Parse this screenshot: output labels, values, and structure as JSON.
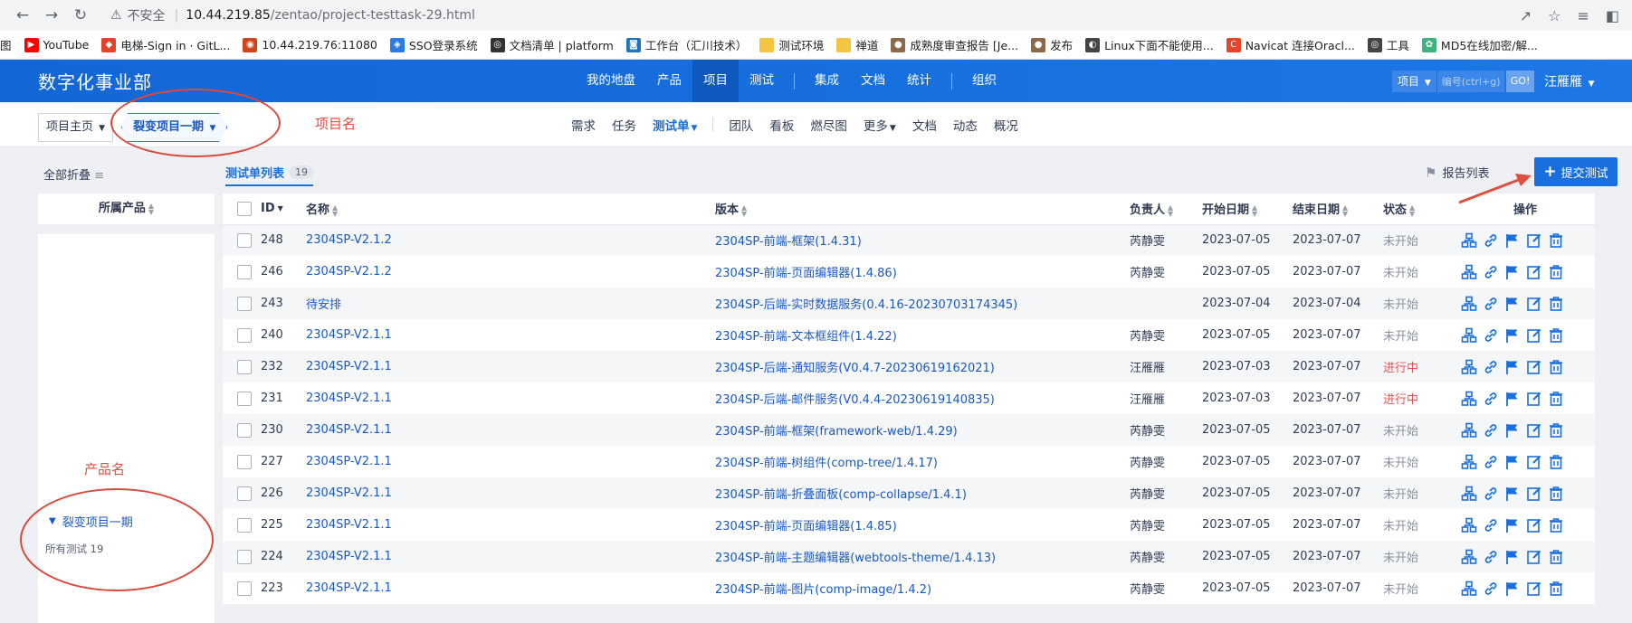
{
  "browser": {
    "insecure_label": "不安全",
    "url_host": "10.44.219.85",
    "url_path": "/zentao/project-testtask-29.html",
    "bookmarks": [
      "图",
      "YouTube",
      "电梯-Sign in · GitL...",
      "10.44.219.76:11080",
      "SSO登录系统",
      "文档清单 | platform",
      "工作台（汇川技术）",
      "测试环境",
      "禅道",
      "成熟度审查报告 [Je...",
      "发布",
      "Linux下面不能使用...",
      "Navicat 连接Oracl...",
      "工具",
      "MD5在线加密/解..."
    ]
  },
  "header": {
    "brand": "数字化事业部",
    "nav": [
      "我的地盘",
      "产品",
      "项目",
      "测试",
      "集成",
      "文档",
      "统计",
      "组织"
    ],
    "active_nav": "项目",
    "search_scope": "项目",
    "search_placeholder": "编号(ctrl+g)",
    "go_label": "GO!",
    "user": "汪雁雁"
  },
  "subheader": {
    "home": "项目主页",
    "project": "裂变项目一期",
    "nav": [
      "需求",
      "任务",
      "测试单",
      "团队",
      "看板",
      "燃尽图",
      "更多",
      "文档",
      "动态",
      "概况"
    ],
    "active_nav": "测试单"
  },
  "toolbar": {
    "collapse_all": "全部折叠",
    "tab_label": "测试单列表",
    "tab_count": "19",
    "report_list": "报告列表",
    "submit_label": "提交测试"
  },
  "sidebar": {
    "header": "所属产品",
    "node": "裂变项目一期",
    "all_tests": "所有测试 19"
  },
  "annotations": {
    "project_name": "项目名",
    "product_name": "产品名"
  },
  "table": {
    "columns": [
      "ID",
      "名称",
      "版本",
      "负责人",
      "开始日期",
      "结束日期",
      "状态",
      "操作"
    ],
    "rows": [
      {
        "id": "248",
        "name": "2304SP-V2.1.2",
        "version": "2304SP-前端-框架(1.4.31)",
        "owner": "芮静雯",
        "start": "2023-07-05",
        "end": "2023-07-07",
        "status": "未开始"
      },
      {
        "id": "246",
        "name": "2304SP-V2.1.2",
        "version": "2304SP-前端-页面编辑器(1.4.86)",
        "owner": "芮静雯",
        "start": "2023-07-05",
        "end": "2023-07-07",
        "status": "未开始"
      },
      {
        "id": "243",
        "name": "待安排",
        "version": "2304SP-后端-实时数据服务(0.4.16-20230703174345)",
        "owner": "",
        "start": "2023-07-04",
        "end": "2023-07-04",
        "status": "未开始"
      },
      {
        "id": "240",
        "name": "2304SP-V2.1.1",
        "version": "2304SP-前端-文本框组件(1.4.22)",
        "owner": "芮静雯",
        "start": "2023-07-05",
        "end": "2023-07-07",
        "status": "未开始"
      },
      {
        "id": "232",
        "name": "2304SP-V2.1.1",
        "version": "2304SP-后端-通知服务(V0.4.7-20230619162021)",
        "owner": "汪雁雁",
        "start": "2023-07-03",
        "end": "2023-07-07",
        "status": "进行中"
      },
      {
        "id": "231",
        "name": "2304SP-V2.1.1",
        "version": "2304SP-后端-邮件服务(V0.4.4-20230619140835)",
        "owner": "汪雁雁",
        "start": "2023-07-03",
        "end": "2023-07-07",
        "status": "进行中"
      },
      {
        "id": "230",
        "name": "2304SP-V2.1.1",
        "version": "2304SP-前端-框架(framework-web/1.4.29)",
        "owner": "芮静雯",
        "start": "2023-07-05",
        "end": "2023-07-07",
        "status": "未开始"
      },
      {
        "id": "227",
        "name": "2304SP-V2.1.1",
        "version": "2304SP-前端-树组件(comp-tree/1.4.17)",
        "owner": "芮静雯",
        "start": "2023-07-05",
        "end": "2023-07-07",
        "status": "未开始"
      },
      {
        "id": "226",
        "name": "2304SP-V2.1.1",
        "version": "2304SP-前端-折叠面板(comp-collapse/1.4.1)",
        "owner": "芮静雯",
        "start": "2023-07-05",
        "end": "2023-07-07",
        "status": "未开始"
      },
      {
        "id": "225",
        "name": "2304SP-V2.1.1",
        "version": "2304SP-前端-页面编辑器(1.4.85)",
        "owner": "芮静雯",
        "start": "2023-07-05",
        "end": "2023-07-07",
        "status": "未开始"
      },
      {
        "id": "224",
        "name": "2304SP-V2.1.1",
        "version": "2304SP-前端-主题编辑器(webtools-theme/1.4.13)",
        "owner": "芮静雯",
        "start": "2023-07-05",
        "end": "2023-07-07",
        "status": "未开始"
      },
      {
        "id": "223",
        "name": "2304SP-V2.1.1",
        "version": "2304SP-前端-图片(comp-image/1.4.2)",
        "owner": "芮静雯",
        "start": "2023-07-05",
        "end": "2023-07-07",
        "status": "未开始"
      }
    ]
  },
  "colors": {
    "primary": "#1a6fde",
    "link": "#1a58c4",
    "status_doing": "#e35454",
    "status_wait": "#8b929e",
    "annotation": "#d94a3c"
  }
}
